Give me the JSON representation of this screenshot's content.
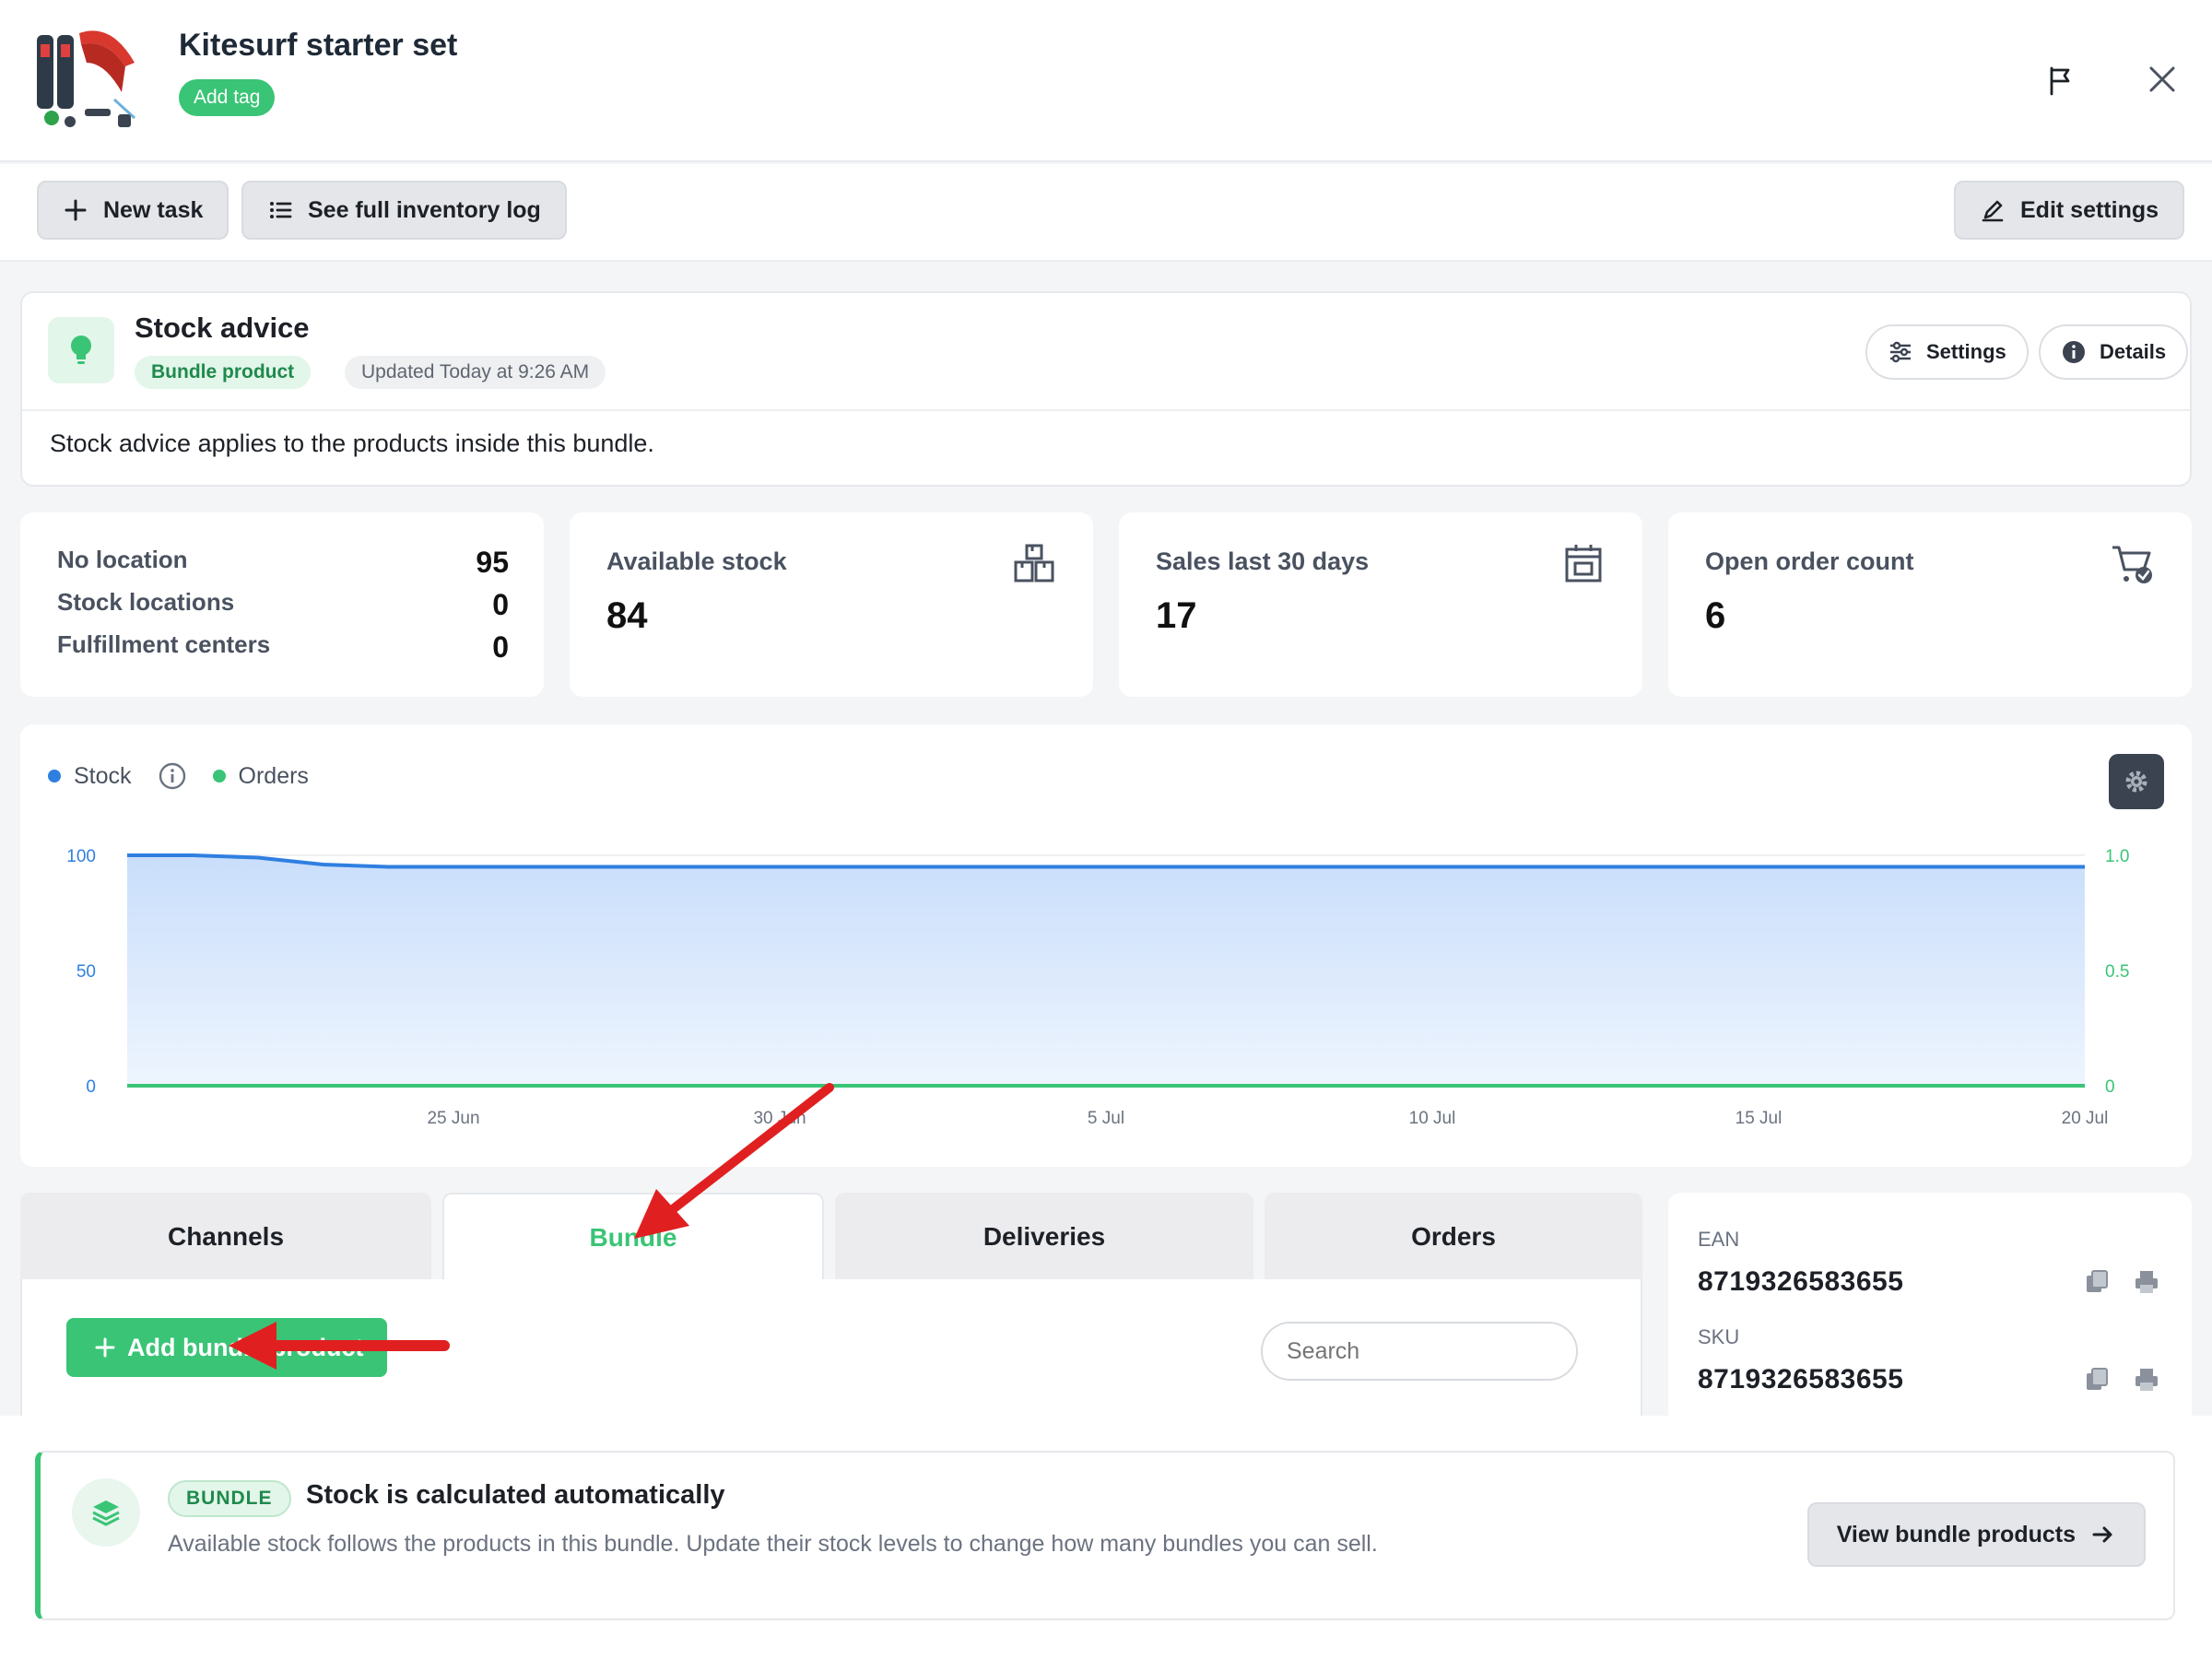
{
  "header": {
    "title": "Kitesurf starter set",
    "add_tag": "Add tag"
  },
  "toolbar": {
    "new_task": "New task",
    "inventory_log": "See full inventory log",
    "edit_settings": "Edit settings"
  },
  "stock_advice": {
    "title": "Stock advice",
    "badge": "Bundle product",
    "updated": "Updated Today at 9:26 AM",
    "settings": "Settings",
    "details": "Details",
    "text": "Stock advice applies to the products inside this bundle."
  },
  "locations": [
    {
      "label": "No location",
      "value": "95"
    },
    {
      "label": "Stock locations",
      "value": "0"
    },
    {
      "label": "Fulfillment centers",
      "value": "0"
    }
  ],
  "stats": [
    {
      "label": "Available stock",
      "value": "84",
      "icon": "warehouse-icon"
    },
    {
      "label": "Sales last 30 days",
      "value": "17",
      "icon": "calendar-icon"
    },
    {
      "label": "Open order count",
      "value": "6",
      "icon": "cart-check-icon"
    }
  ],
  "chart_data": {
    "type": "line",
    "legend": [
      "Stock",
      "Orders"
    ],
    "x_ticks": [
      "25 Jun",
      "30 Jun",
      "5 Jul",
      "10 Jul",
      "15 Jul",
      "20 Jul"
    ],
    "y_left_ticks": [
      "0",
      "50",
      "100"
    ],
    "y_right_ticks": [
      "0",
      "0.5",
      "1.0"
    ],
    "ylim_left": [
      0,
      100
    ],
    "ylim_right": [
      0,
      1
    ],
    "series": [
      {
        "name": "Stock",
        "color": "#2f7fe0",
        "axis": "left",
        "x": [
          "20 Jun",
          "21 Jun",
          "22 Jun",
          "23 Jun",
          "24 Jun",
          "20 Jul"
        ],
        "values": [
          100,
          100,
          99,
          96,
          95,
          95
        ]
      },
      {
        "name": "Orders",
        "color": "#3ac476",
        "axis": "right",
        "x": [
          "20 Jun",
          "20 Jul"
        ],
        "values": [
          0,
          0
        ]
      }
    ]
  },
  "tabs": [
    {
      "label": "Channels",
      "active": false
    },
    {
      "label": "Bundle",
      "active": true
    },
    {
      "label": "Deliveries",
      "active": false
    },
    {
      "label": "Orders",
      "active": false
    }
  ],
  "bundle_panel": {
    "add_button": "Add bundle product",
    "search_placeholder": "Search"
  },
  "identifiers": {
    "ean_label": "EAN",
    "ean": "8719326583655",
    "sku_label": "SKU",
    "sku": "8719326583655"
  },
  "banner": {
    "chip": "BUNDLE",
    "title": "Stock is calculated automatically",
    "text": "Available stock follows the products in this bundle. Update their stock levels to change how many bundles you can sell.",
    "button": "View bundle products"
  },
  "colors": {
    "accent": "#3ac476",
    "stock_line": "#2f7fe0",
    "annotation_arrow": "#e02020"
  }
}
